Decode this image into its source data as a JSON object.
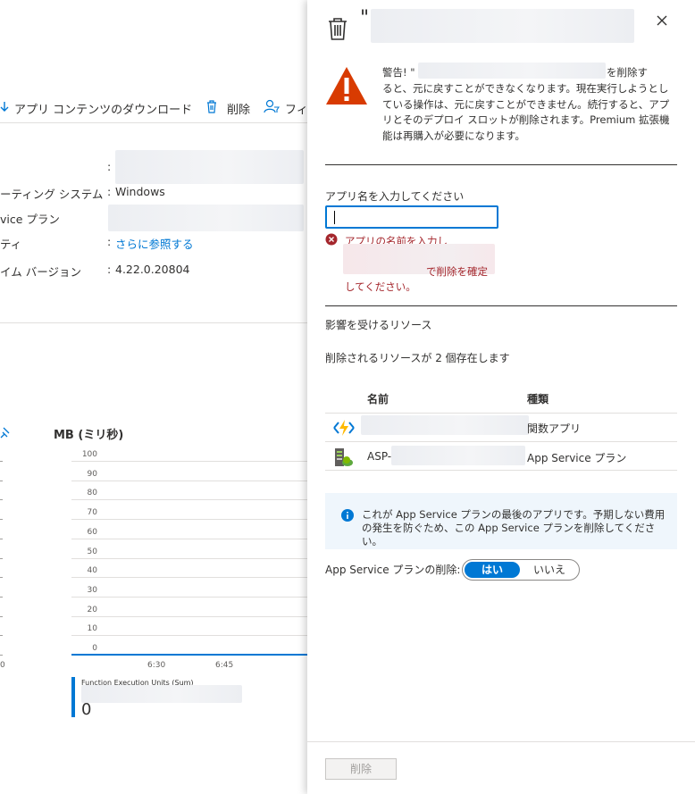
{
  "background": {
    "toolbar": {
      "download_label": "アプリ コンテンツのダウンロード",
      "delete_label": "削除",
      "filter_label": "フィ"
    },
    "properties": [
      {
        "label": "ーティング システム",
        "value": "Windows"
      },
      {
        "label": "vice プラン",
        "value": ""
      },
      {
        "label": "ティ",
        "value": "さらに参照する"
      },
      {
        "label": "イム バージョン",
        "value": "4.22.0.20804"
      }
    ],
    "chart": {
      "title": "MB (ミリ秒)",
      "legend_label": "Function Execution Units (Sum)",
      "legend_value": "0"
    }
  },
  "chart_data": {
    "type": "line",
    "title": "MB (ミリ秒)",
    "y_ticks": [
      "100",
      "90",
      "80",
      "70",
      "60",
      "50",
      "40",
      "30",
      "20",
      "10",
      "0"
    ],
    "x_ticks": [
      "0",
      "6:30",
      "6:45"
    ],
    "ylim": [
      0,
      100
    ],
    "series": [
      {
        "name": "Function Execution Units (Sum)",
        "values": [
          0,
          0,
          0
        ]
      }
    ],
    "grid": true
  },
  "panel": {
    "title_prefix": "\"",
    "close_icon": "close-icon",
    "warning": {
      "line1_prefix": "警告! \"",
      "line1_suffix": "を削除す",
      "body": "ると、元に戻すことができなくなります。現在実行しようとしている操作は、元に戻すことができません。続行すると、アプリとそのデプロイ スロットが削除されます。Premium 拡張機能は再購入が必要になります。"
    },
    "input": {
      "label": "アプリ名を入力してください",
      "value": ""
    },
    "error": {
      "line1": "アプリの名前を入力し",
      "line2_suffix": "で削除を確定",
      "line3": "してください。"
    },
    "affected_heading": "影響を受けるリソース",
    "affected_count": "削除されるリソースが 2 個存在します",
    "table": {
      "col_name": "名前",
      "col_type": "種類",
      "rows": [
        {
          "name": "",
          "type": "関数アプリ",
          "icon": "function-app-icon"
        },
        {
          "name": "ASP-",
          "type": "App Service プラン",
          "icon": "app-service-plan-icon"
        }
      ]
    },
    "info_text": "これが App Service プランの最後のアプリです。予期しない費用の発生を防ぐため、この App Service プランを削除してください。",
    "delete_plan_label": "App Service プランの削除:",
    "toggle_yes": "はい",
    "toggle_no": "いいえ",
    "delete_button": "削除",
    "colors": {
      "accent": "#0078d4",
      "warning": "#d83b01",
      "error": "#a4262c",
      "info_bg": "#eff6fc"
    }
  }
}
